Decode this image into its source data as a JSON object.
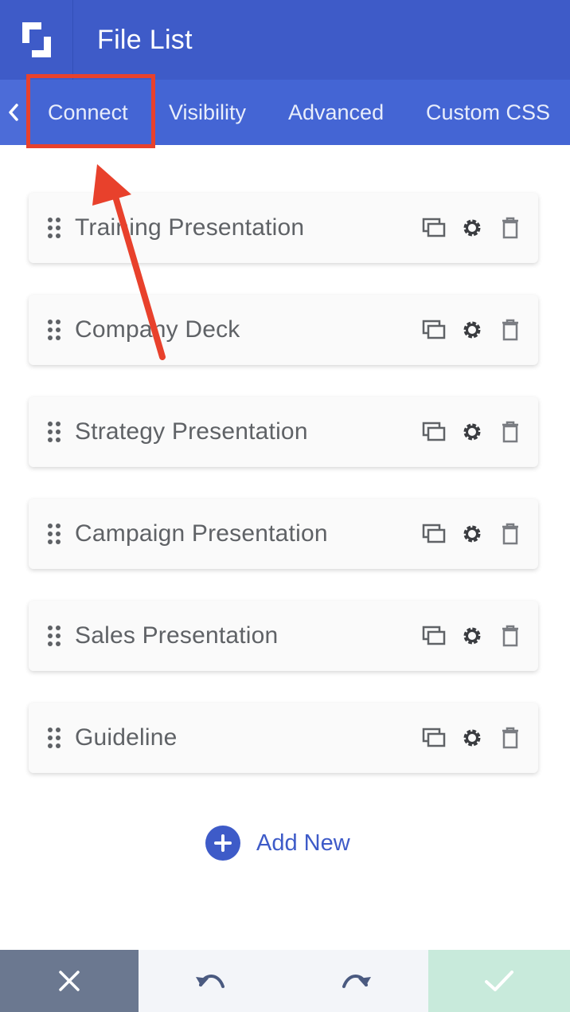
{
  "header": {
    "title": "File List",
    "logo_icon": "logo-icon"
  },
  "tabs": [
    {
      "label": "Connect",
      "active": true
    },
    {
      "label": "Visibility"
    },
    {
      "label": "Advanced"
    },
    {
      "label": "Custom CSS"
    }
  ],
  "items": [
    {
      "label": "Training Presentation"
    },
    {
      "label": "Company Deck"
    },
    {
      "label": "Strategy Presentation"
    },
    {
      "label": "Campaign Presentation"
    },
    {
      "label": "Sales Presentation"
    },
    {
      "label": "Guideline"
    }
  ],
  "item_actions": [
    "duplicate-icon",
    "gear-icon",
    "trash-icon"
  ],
  "add_new": {
    "label": "Add New"
  },
  "colors": {
    "primary": "#3e5bc8",
    "tab_bar": "#4465d4",
    "annotation": "#e8412c",
    "close_bg": "#6b7890",
    "confirm_bg": "#c8eadb"
  }
}
